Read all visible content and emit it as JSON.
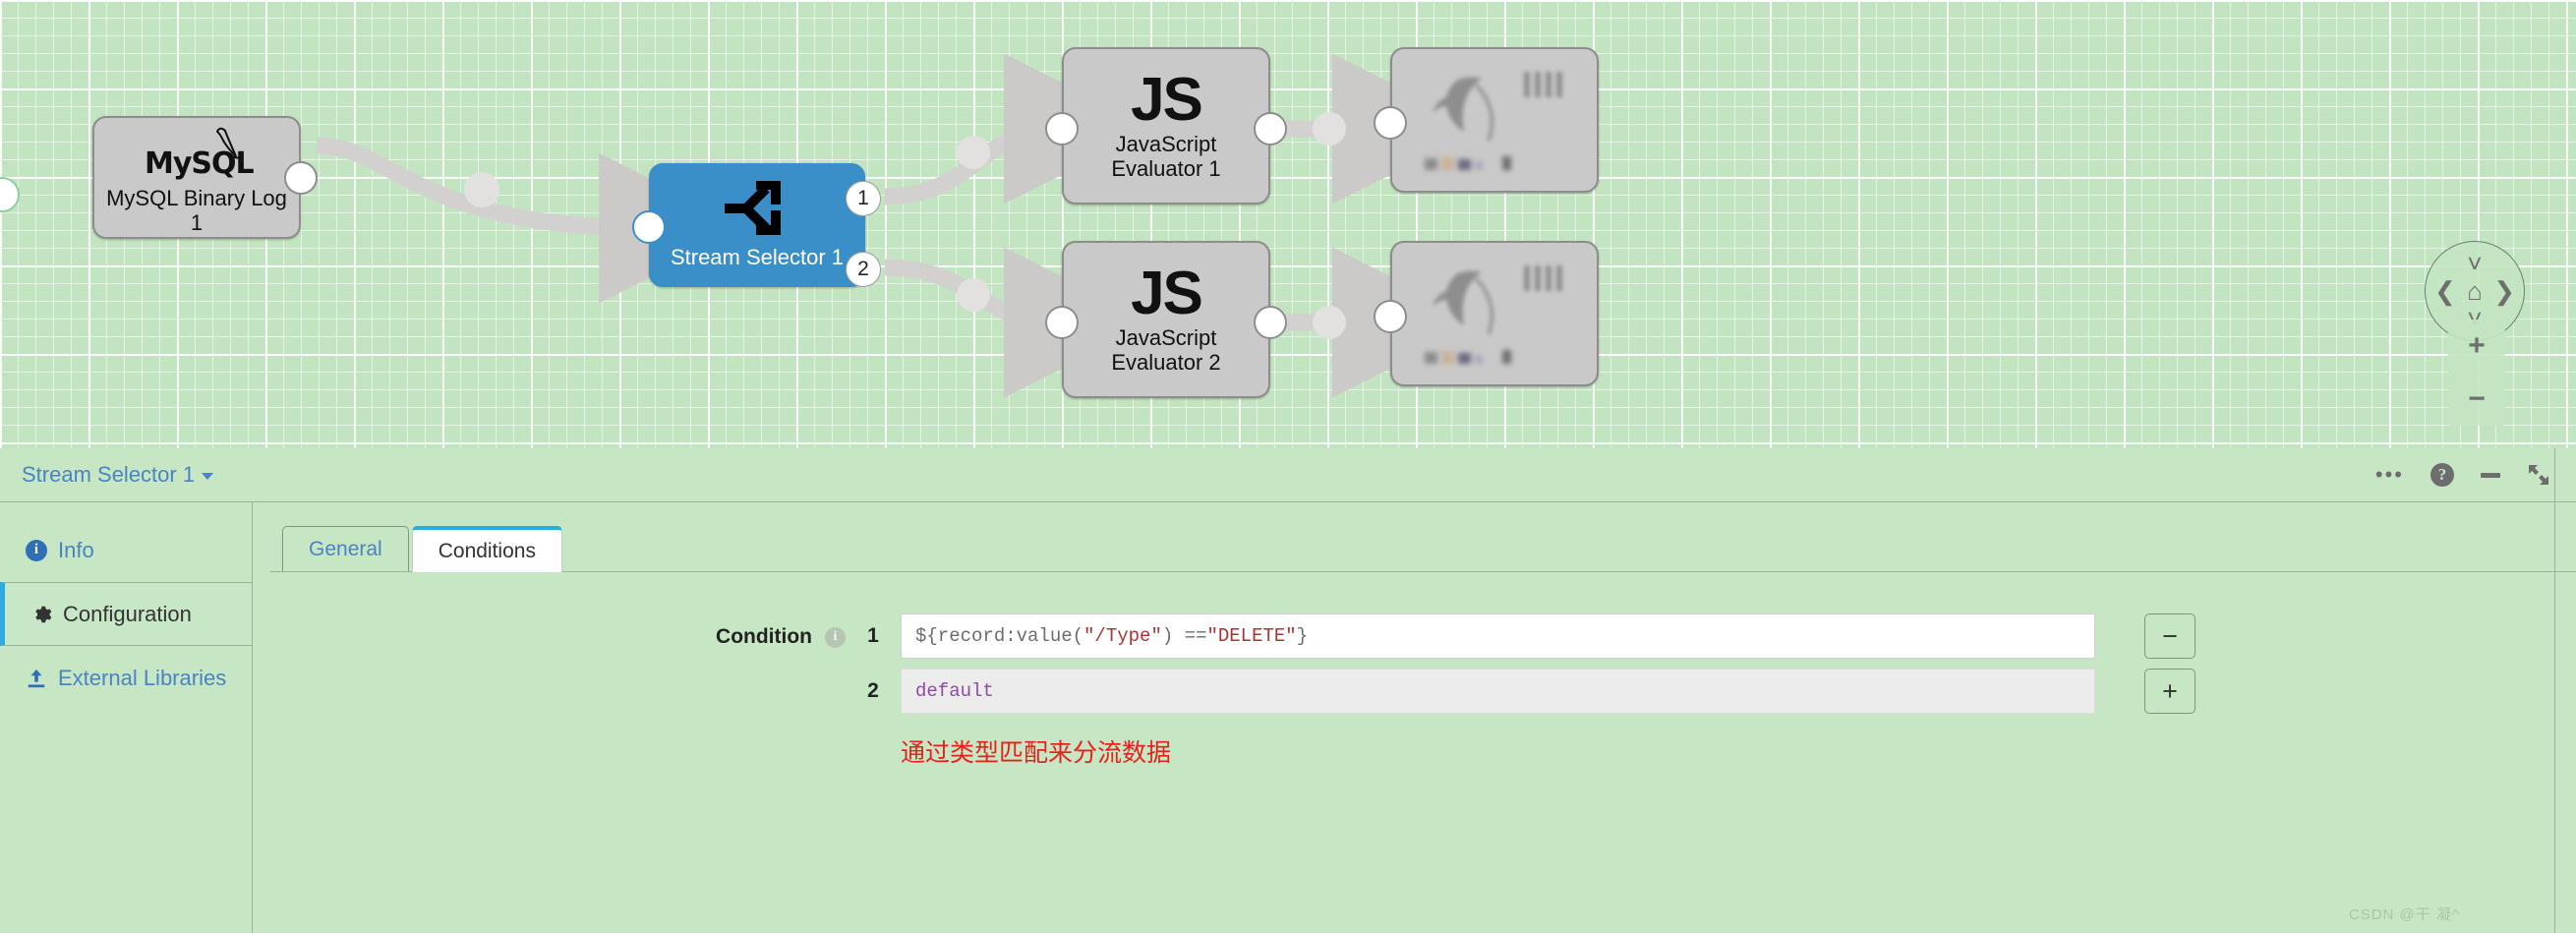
{
  "canvas": {
    "nodes": [
      {
        "id": "mysql",
        "label": "MySQL Binary Log 1",
        "icon": "mysql-icon",
        "type": "origin",
        "logo_text": "MySQL"
      },
      {
        "id": "stream",
        "label": "Stream Selector 1",
        "icon": "stream-selector-icon",
        "type": "processor",
        "selected": true,
        "output_ports": [
          "1",
          "2"
        ]
      },
      {
        "id": "js1",
        "label": "JavaScript Evaluator 1",
        "icon": "javascript-icon",
        "type": "processor",
        "logo_text": "JS"
      },
      {
        "id": "js2",
        "label": "JavaScript Evaluator 2",
        "icon": "javascript-icon",
        "type": "processor",
        "logo_text": "JS"
      },
      {
        "id": "dest1",
        "label": "",
        "icon": "kudu-icon",
        "type": "destination"
      },
      {
        "id": "dest2",
        "label": "",
        "icon": "kudu-icon",
        "type": "destination"
      }
    ],
    "controls": {
      "pan_up": "chevron-up",
      "pan_down": "chevron-down",
      "pan_left": "chevron-left",
      "pan_right": "chevron-right",
      "home": "home",
      "zoom_in": "+",
      "zoom_out": "−"
    }
  },
  "panel": {
    "title": "Stream Selector 1",
    "actions": {
      "more_label": "•••",
      "help_label": "?",
      "minimize_label": "",
      "expand_label": ""
    },
    "side_nav": [
      {
        "label": "Info",
        "icon": "info-icon",
        "active": false
      },
      {
        "label": "Configuration",
        "icon": "gear-icon",
        "active": true
      },
      {
        "label": "External Libraries",
        "icon": "upload-icon",
        "active": false
      }
    ],
    "tabs": [
      {
        "label": "General",
        "active": false
      },
      {
        "label": "Conditions",
        "active": true
      }
    ],
    "form": {
      "condition_label": "Condition",
      "conditions": [
        {
          "index": "1",
          "value": "${record:value(\"/Type\") == \"DELETE\"}",
          "segments": [
            {
              "text": "${record:value(",
              "style": "plain"
            },
            {
              "text": "\"/Type\"",
              "style": "string"
            },
            {
              "text": ") == ",
              "style": "plain"
            },
            {
              "text": "\"DELETE\"",
              "style": "string"
            },
            {
              "text": "}",
              "style": "plain"
            }
          ],
          "disabled": false
        },
        {
          "index": "2",
          "value": "default",
          "segments": [
            {
              "text": "default",
              "style": "default-keyword"
            }
          ],
          "disabled": true
        }
      ],
      "remove_button_label": "−",
      "add_button_label": "+",
      "note": "通过类型匹配来分流数据"
    }
  },
  "watermark": "CSDN @干 凝^",
  "colors": {
    "canvas_bg": "#c3e4c1",
    "node_grey": "#c9c9c9",
    "node_blue": "#3a8fc8",
    "link_blue": "#4a84c4",
    "accent_blue": "#2aabe2",
    "note_red": "#e8201a",
    "string_red": "#aa3333",
    "keyword_purple": "#8d4ba3"
  }
}
